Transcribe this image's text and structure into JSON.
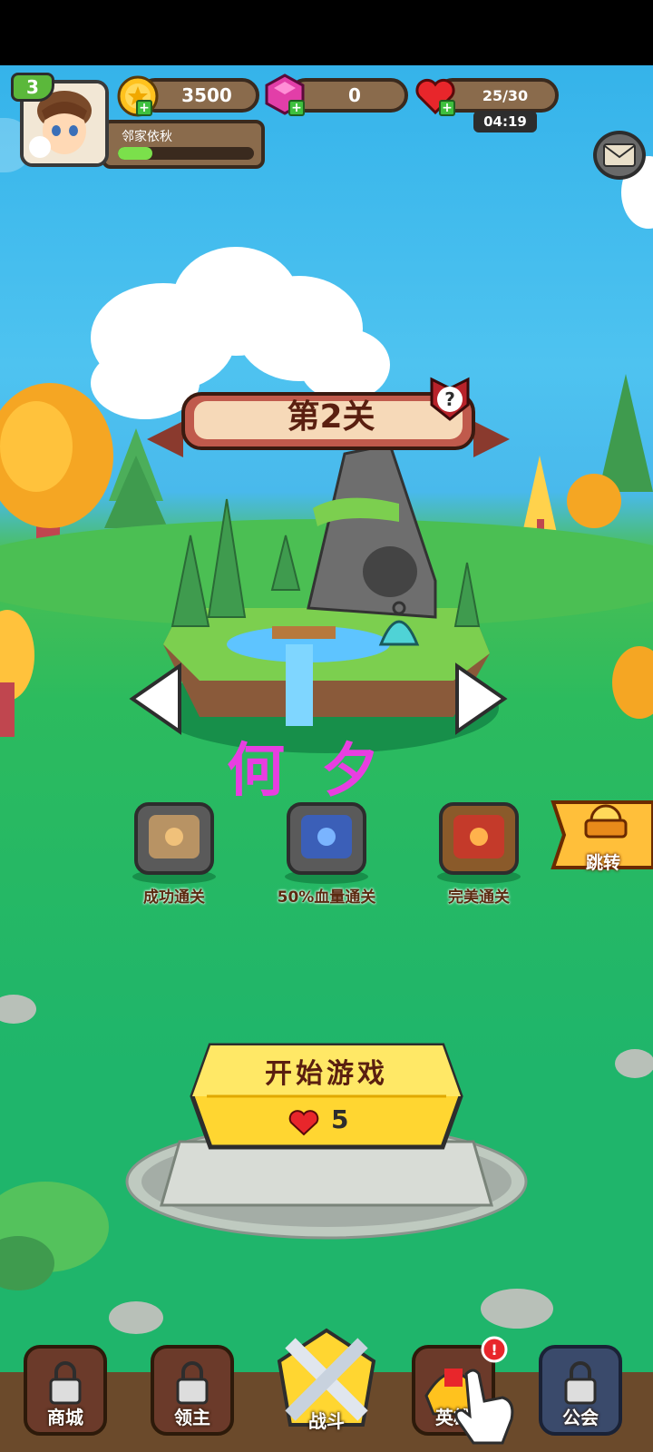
{
  "player": {
    "level": "3",
    "name": "邻家依秋",
    "exp_fraction": 0.25
  },
  "resources": {
    "coins": "3500",
    "gems": "0",
    "hearts": "25/30",
    "heart_timer": "04:19"
  },
  "stage": {
    "title": "第2关",
    "help_icon": "question-icon"
  },
  "watermark": "何夕",
  "rewards": [
    {
      "label": "成功通关",
      "color": "#b89364"
    },
    {
      "label": "50%血量通关",
      "color": "#3b5fb8"
    },
    {
      "label": "完美通关",
      "color": "#c43a2a"
    }
  ],
  "jump": {
    "label": "跳转"
  },
  "start": {
    "label": "开始游戏",
    "cost": "5"
  },
  "bottom_nav": [
    {
      "label": "商城",
      "icon": "lock-icon",
      "locked": true
    },
    {
      "label": "领主",
      "icon": "lock-icon",
      "locked": true
    },
    {
      "label": "战斗",
      "icon": "swords-icon",
      "locked": false
    },
    {
      "label": "英雄",
      "icon": "helmet-icon",
      "locked": false
    },
    {
      "label": "公会",
      "icon": "lock-icon",
      "locked": true
    }
  ],
  "colors": {
    "sky": "#4ec3f0",
    "grass": "#1fb56b",
    "banner": "#b5574a",
    "start_yellow": "#ffd631"
  }
}
